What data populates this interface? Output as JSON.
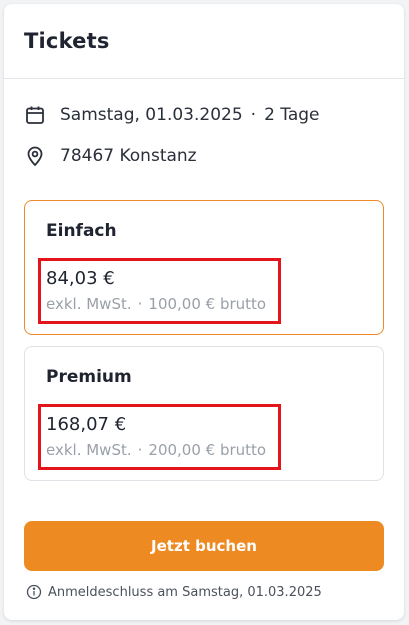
{
  "header": {
    "title": "Tickets"
  },
  "event": {
    "date": "Samstag, 01.03.2025",
    "separator": "·",
    "duration": "2 Tage",
    "location": "78467 Konstanz"
  },
  "options": [
    {
      "name": "Einfach",
      "price": "84,03 €",
      "tax_note": "exkl. MwSt.",
      "separator": "·",
      "gross": "100,00 € brutto",
      "selected": true
    },
    {
      "name": "Premium",
      "price": "168,07 €",
      "tax_note": "exkl. MwSt.",
      "separator": "·",
      "gross": "200,00 € brutto",
      "selected": false
    }
  ],
  "actions": {
    "book_label": "Jetzt buchen"
  },
  "footer": {
    "deadline": "Anmeldeschluss am Samstag, 01.03.2025"
  },
  "icons": {
    "date": "calendar-icon",
    "location": "location-pin-icon",
    "info": "info-icon"
  },
  "colors": {
    "accent": "#ee8a22",
    "highlight_border": "#e3151a"
  }
}
